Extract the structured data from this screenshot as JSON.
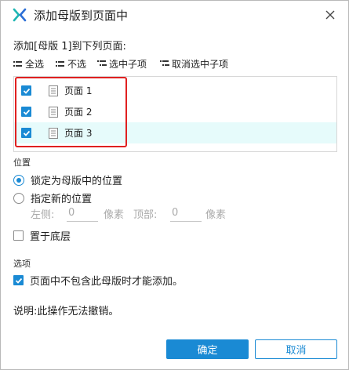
{
  "window": {
    "title": "添加母版到页面中"
  },
  "intro": {
    "label": "添加[母版 1]到下列页面:"
  },
  "toolbar": {
    "select_all": "全选",
    "select_none": "不选",
    "select_children": "选中子项",
    "deselect_children": "取消选中子项"
  },
  "pages": [
    {
      "label": "页面 1",
      "checked": true
    },
    {
      "label": "页面 2",
      "checked": true
    },
    {
      "label": "页面 3",
      "checked": true
    }
  ],
  "position": {
    "heading": "位置",
    "lock_option": "锁定为母版中的位置",
    "custom_option": "指定新的位置",
    "left_label": "左侧:",
    "left_value": "0",
    "unit1": "像素",
    "top_label": "顶部:",
    "top_value": "0",
    "unit2": "像素",
    "bottom_layer": "置于底层"
  },
  "options": {
    "heading": "选项",
    "only_if_absent": "页面中不包含此母版时才能添加。"
  },
  "note": "说明:此操作无法撤销。",
  "buttons": {
    "ok": "确定",
    "cancel": "取消"
  },
  "colors": {
    "accent": "#1a8ad4",
    "highlight_box": "#e02020",
    "selected_row": "#e6fbfb"
  }
}
